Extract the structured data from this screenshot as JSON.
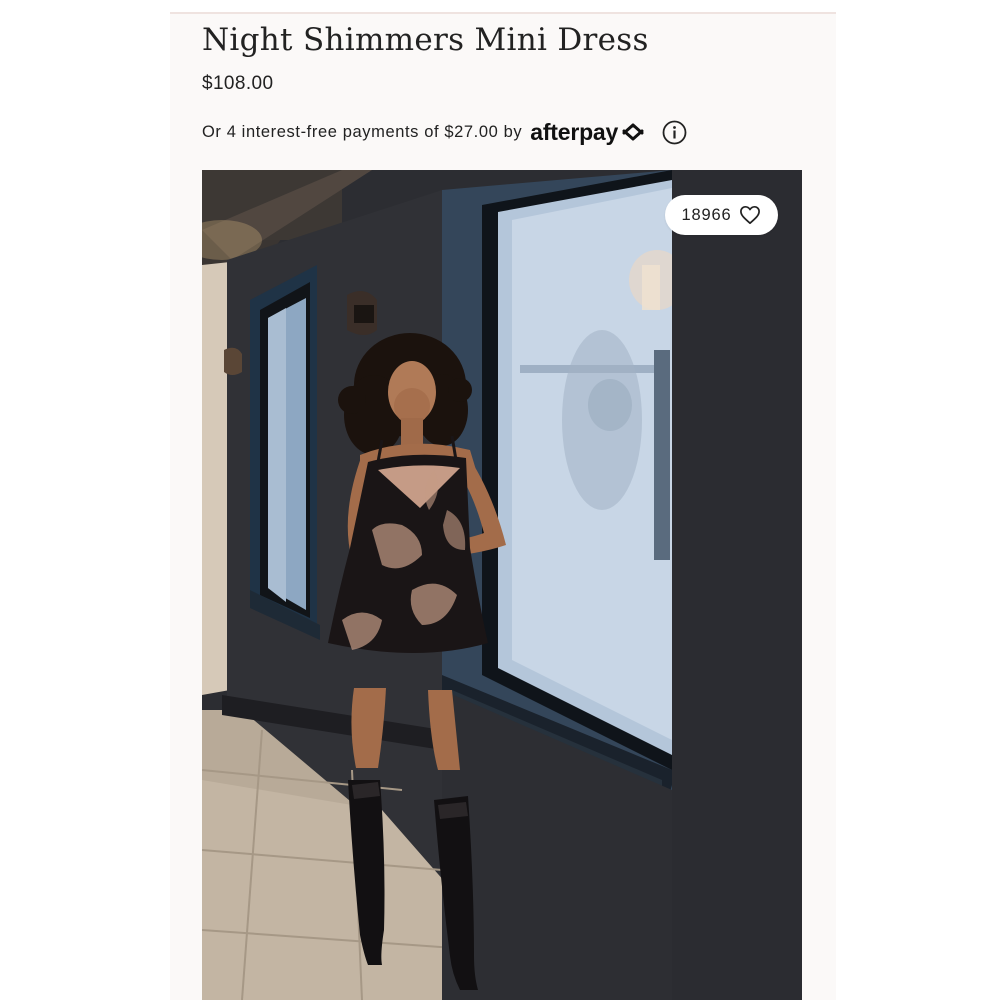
{
  "product": {
    "title": "Night Shimmers Mini Dress",
    "price": "$108.00"
  },
  "installments": {
    "text": "Or 4 interest-free payments of $27.00 by",
    "provider_logo": "afterpay",
    "provider_icon": "afterpay-arrows-icon",
    "info_icon": "info-icon"
  },
  "image": {
    "likes_count": "18966",
    "like_icon": "heart-icon"
  },
  "colors": {
    "panel_background": "#fbf9f8",
    "text": "#222222",
    "wall": "#2e2f34",
    "pill_background": "#ffffff"
  }
}
